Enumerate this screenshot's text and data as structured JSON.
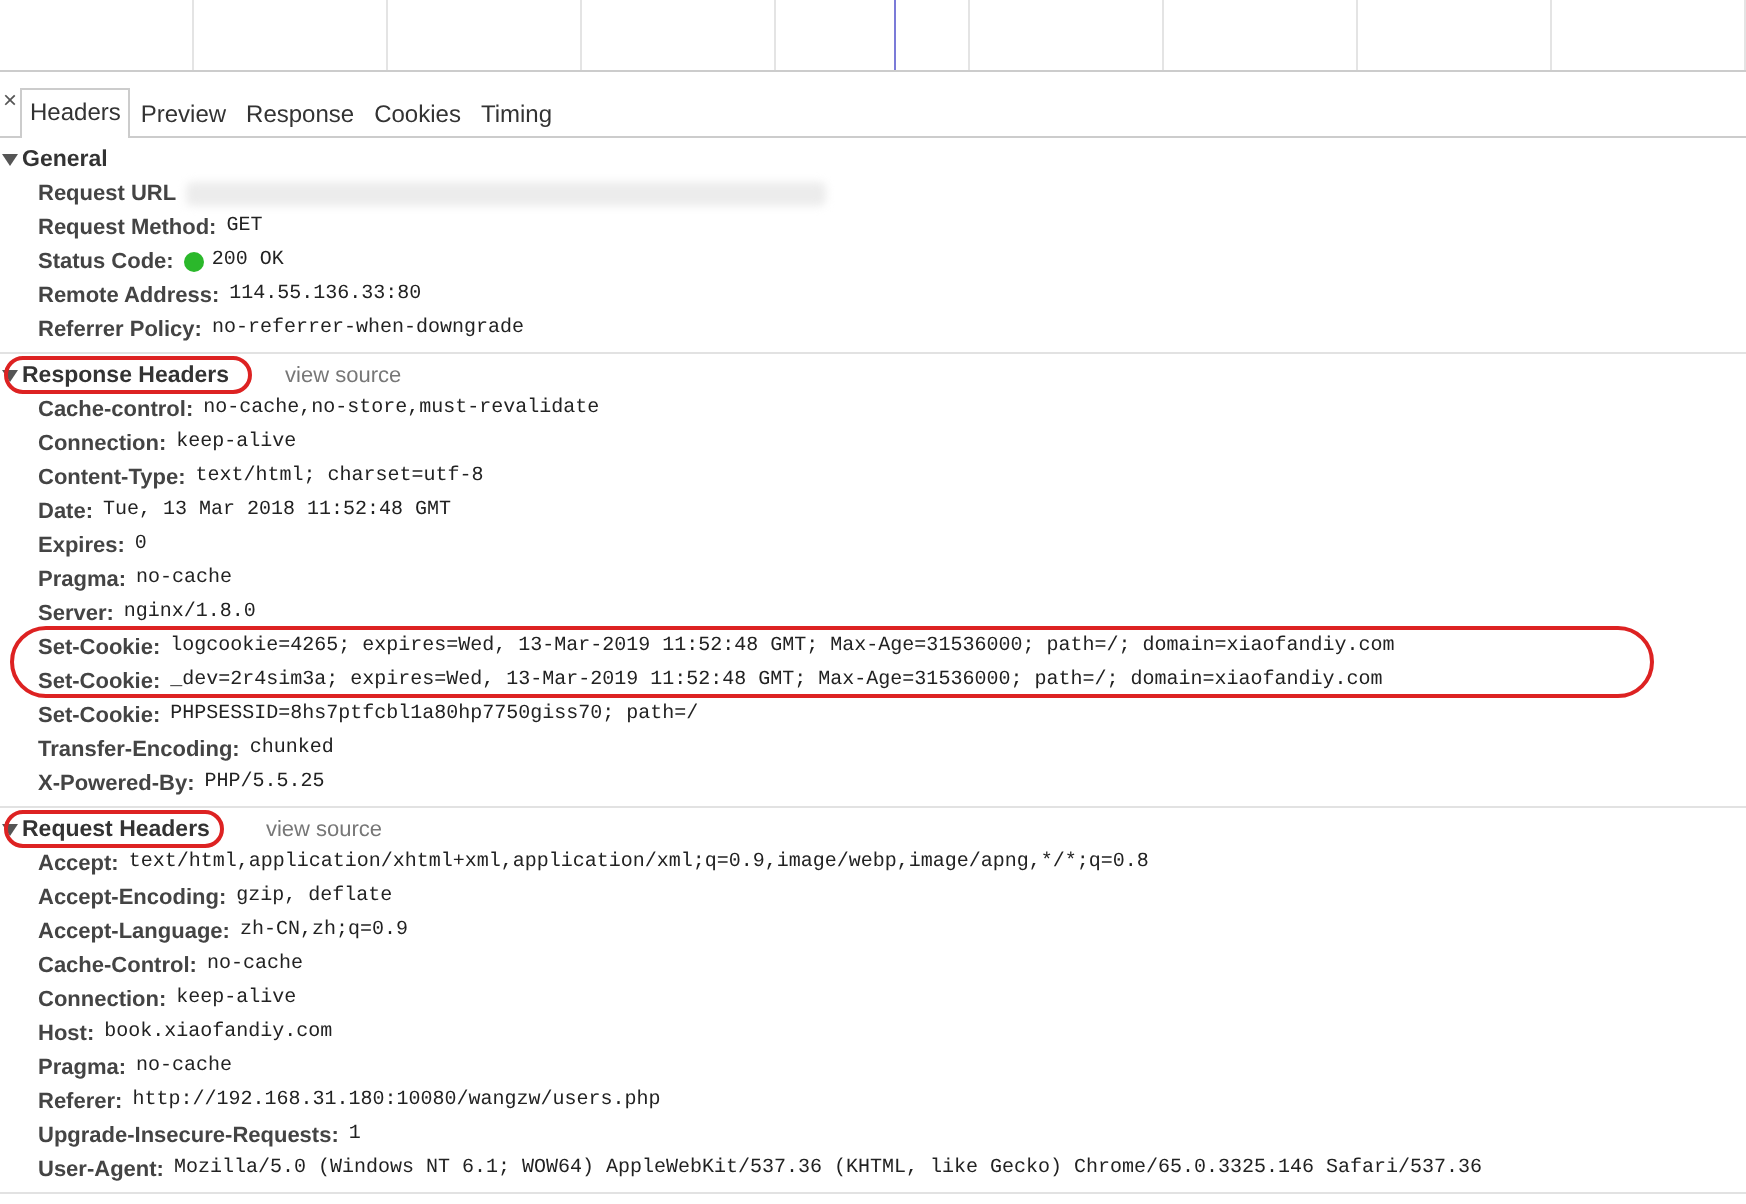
{
  "tabs": [
    {
      "label": "Headers",
      "selected": true
    },
    {
      "label": "Preview",
      "selected": false
    },
    {
      "label": "Response",
      "selected": false
    },
    {
      "label": "Cookies",
      "selected": false
    },
    {
      "label": "Timing",
      "selected": false
    }
  ],
  "close": "×",
  "sections": [
    {
      "title": "General",
      "expanded": true,
      "circled": false,
      "rows": [
        {
          "kind": "redacted",
          "name": "Request URL",
          "value": ""
        },
        {
          "kind": "plain",
          "name": "Request Method:",
          "value": "GET"
        },
        {
          "kind": "status",
          "name": "Status Code:",
          "value": "200 OK"
        },
        {
          "kind": "plain",
          "name": "Remote Address:",
          "value": "114.55.136.33:80"
        },
        {
          "kind": "plain",
          "name": "Referrer Policy:",
          "value": "no-referrer-when-downgrade"
        }
      ]
    },
    {
      "title": "Response Headers",
      "expanded": true,
      "circled": true,
      "view_source": "view source",
      "rows": [
        {
          "kind": "plain",
          "name": "Cache-control:",
          "value": "no-cache,no-store,must-revalidate"
        },
        {
          "kind": "plain",
          "name": "Connection:",
          "value": "keep-alive"
        },
        {
          "kind": "plain",
          "name": "Content-Type:",
          "value": "text/html; charset=utf-8"
        },
        {
          "kind": "plain",
          "name": "Date:",
          "value": "Tue, 13 Mar 2018 11:52:48 GMT"
        },
        {
          "kind": "plain",
          "name": "Expires:",
          "value": "0"
        },
        {
          "kind": "plain",
          "name": "Pragma:",
          "value": "no-cache"
        },
        {
          "kind": "plain",
          "name": "Server:",
          "value": "nginx/1.8.0"
        },
        {
          "kind": "plain",
          "name": "Set-Cookie:",
          "value": "logcookie=4265; expires=Wed, 13-Mar-2019 11:52:48 GMT; Max-Age=31536000; path=/; domain=xiaofandiy.com"
        },
        {
          "kind": "plain",
          "name": "Set-Cookie:",
          "value": "_dev=2r4sim3a; expires=Wed, 13-Mar-2019 11:52:48 GMT; Max-Age=31536000; path=/; domain=xiaofandiy.com"
        },
        {
          "kind": "plain",
          "name": "Set-Cookie:",
          "value": "PHPSESSID=8hs7ptfcbl1a80hp7750giss70; path=/"
        },
        {
          "kind": "plain",
          "name": "Transfer-Encoding:",
          "value": "chunked"
        },
        {
          "kind": "plain",
          "name": "X-Powered-By:",
          "value": "PHP/5.5.25"
        }
      ]
    },
    {
      "title": "Request Headers",
      "expanded": true,
      "circled": true,
      "view_source": "view source",
      "rows": [
        {
          "kind": "plain",
          "name": "Accept:",
          "value": "text/html,application/xhtml+xml,application/xml;q=0.9,image/webp,image/apng,*/*;q=0.8"
        },
        {
          "kind": "plain",
          "name": "Accept-Encoding:",
          "value": "gzip, deflate"
        },
        {
          "kind": "plain",
          "name": "Accept-Language:",
          "value": "zh-CN,zh;q=0.9"
        },
        {
          "kind": "plain",
          "name": "Cache-Control:",
          "value": "no-cache"
        },
        {
          "kind": "plain",
          "name": "Connection:",
          "value": "keep-alive"
        },
        {
          "kind": "plain",
          "name": "Host:",
          "value": "book.xiaofandiy.com"
        },
        {
          "kind": "plain",
          "name": "Pragma:",
          "value": "no-cache"
        },
        {
          "kind": "plain",
          "name": "Referer:",
          "value": "http://192.168.31.180:10080/wangzw/users.php"
        },
        {
          "kind": "plain",
          "name": "Upgrade-Insecure-Requests:",
          "value": "1"
        },
        {
          "kind": "plain",
          "name": "User-Agent:",
          "value": "Mozilla/5.0 (Windows NT 6.1; WOW64) AppleWebKit/537.36 (KHTML, like Gecko) Chrome/65.0.3325.146 Safari/537.36"
        }
      ]
    }
  ]
}
